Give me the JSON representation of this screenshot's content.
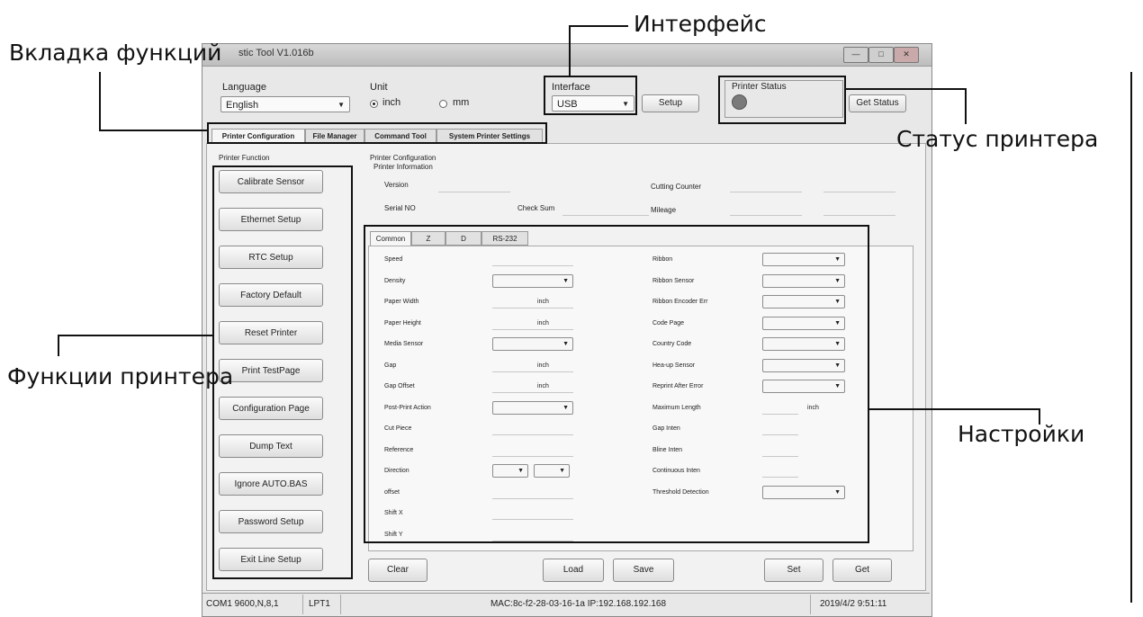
{
  "window": {
    "title": "stic Tool V1.016b",
    "controls": [
      "—",
      "□",
      "✕"
    ]
  },
  "header": {
    "language_label": "Language",
    "language_value": "English",
    "unit_label": "Unit",
    "unit_inch": "inch",
    "unit_mm": "mm",
    "interface_label": "Interface",
    "interface_value": "USB",
    "setup_button": "Setup",
    "printer_status_label": "Printer  Status",
    "get_status_button": "Get Status",
    "status_color": "#7a7a7a"
  },
  "tabs": [
    "Printer Configuration",
    "File Manager",
    "Command Tool",
    "System Printer Settings"
  ],
  "printer_function": {
    "label": "Printer  Function",
    "buttons": [
      "Calibrate Sensor",
      "Ethernet Setup",
      "RTC Setup",
      "Factory Default",
      "Reset Printer",
      "Print TestPage",
      "Configuration Page",
      "Dump Text",
      "Ignore AUTO.BAS",
      "Password Setup",
      "Exit Line Setup"
    ]
  },
  "config": {
    "title": "Printer Configuration",
    "info_title": "Printer Information",
    "version": "Version",
    "serial": "Serial NO",
    "checksum": "Check Sum",
    "cutting": "Cutting Counter",
    "mileage": "Mileage"
  },
  "subtabs": [
    "Common",
    "Z",
    "D",
    "RS-232"
  ],
  "left_fields": [
    "Speed",
    "Density",
    "Paper Width",
    "Paper Height",
    "Media Sensor",
    "Gap",
    "Gap Offset",
    "Post-Print  Action",
    "Cut  Piece",
    "Reference",
    "Direction",
    "offset",
    "Shift X",
    "Shift Y"
  ],
  "unit_text": "inch",
  "right_fields": [
    "Ribbon",
    "Ribbon  Sensor",
    "Ribbon Encoder Err",
    "Code Page",
    "Country Code",
    "Hea-up  Sensor",
    "Reprint After  Error",
    "Maximum Length",
    "Gap  Inten",
    "Bline  Inten",
    "Continuous  Inten",
    "Threshold  Detection"
  ],
  "bottom_buttons": {
    "clear": "Clear",
    "load": "Load",
    "save": "Save",
    "set": "Set",
    "get": "Get"
  },
  "statusbar": {
    "com": "COM1 9600,N,8,1",
    "lpt": "LPT1",
    "network": "MAC:8c-f2-28-03-16-1a   IP:192.168.192.168",
    "datetime": "2019/4/2 9:51:11"
  },
  "annotations": {
    "tab_functions": "Вкладка функций",
    "interface": "Интерфейс",
    "printer_status": "Статус принтера",
    "printer_functions": "Функции принтера",
    "settings": "Настройки"
  }
}
